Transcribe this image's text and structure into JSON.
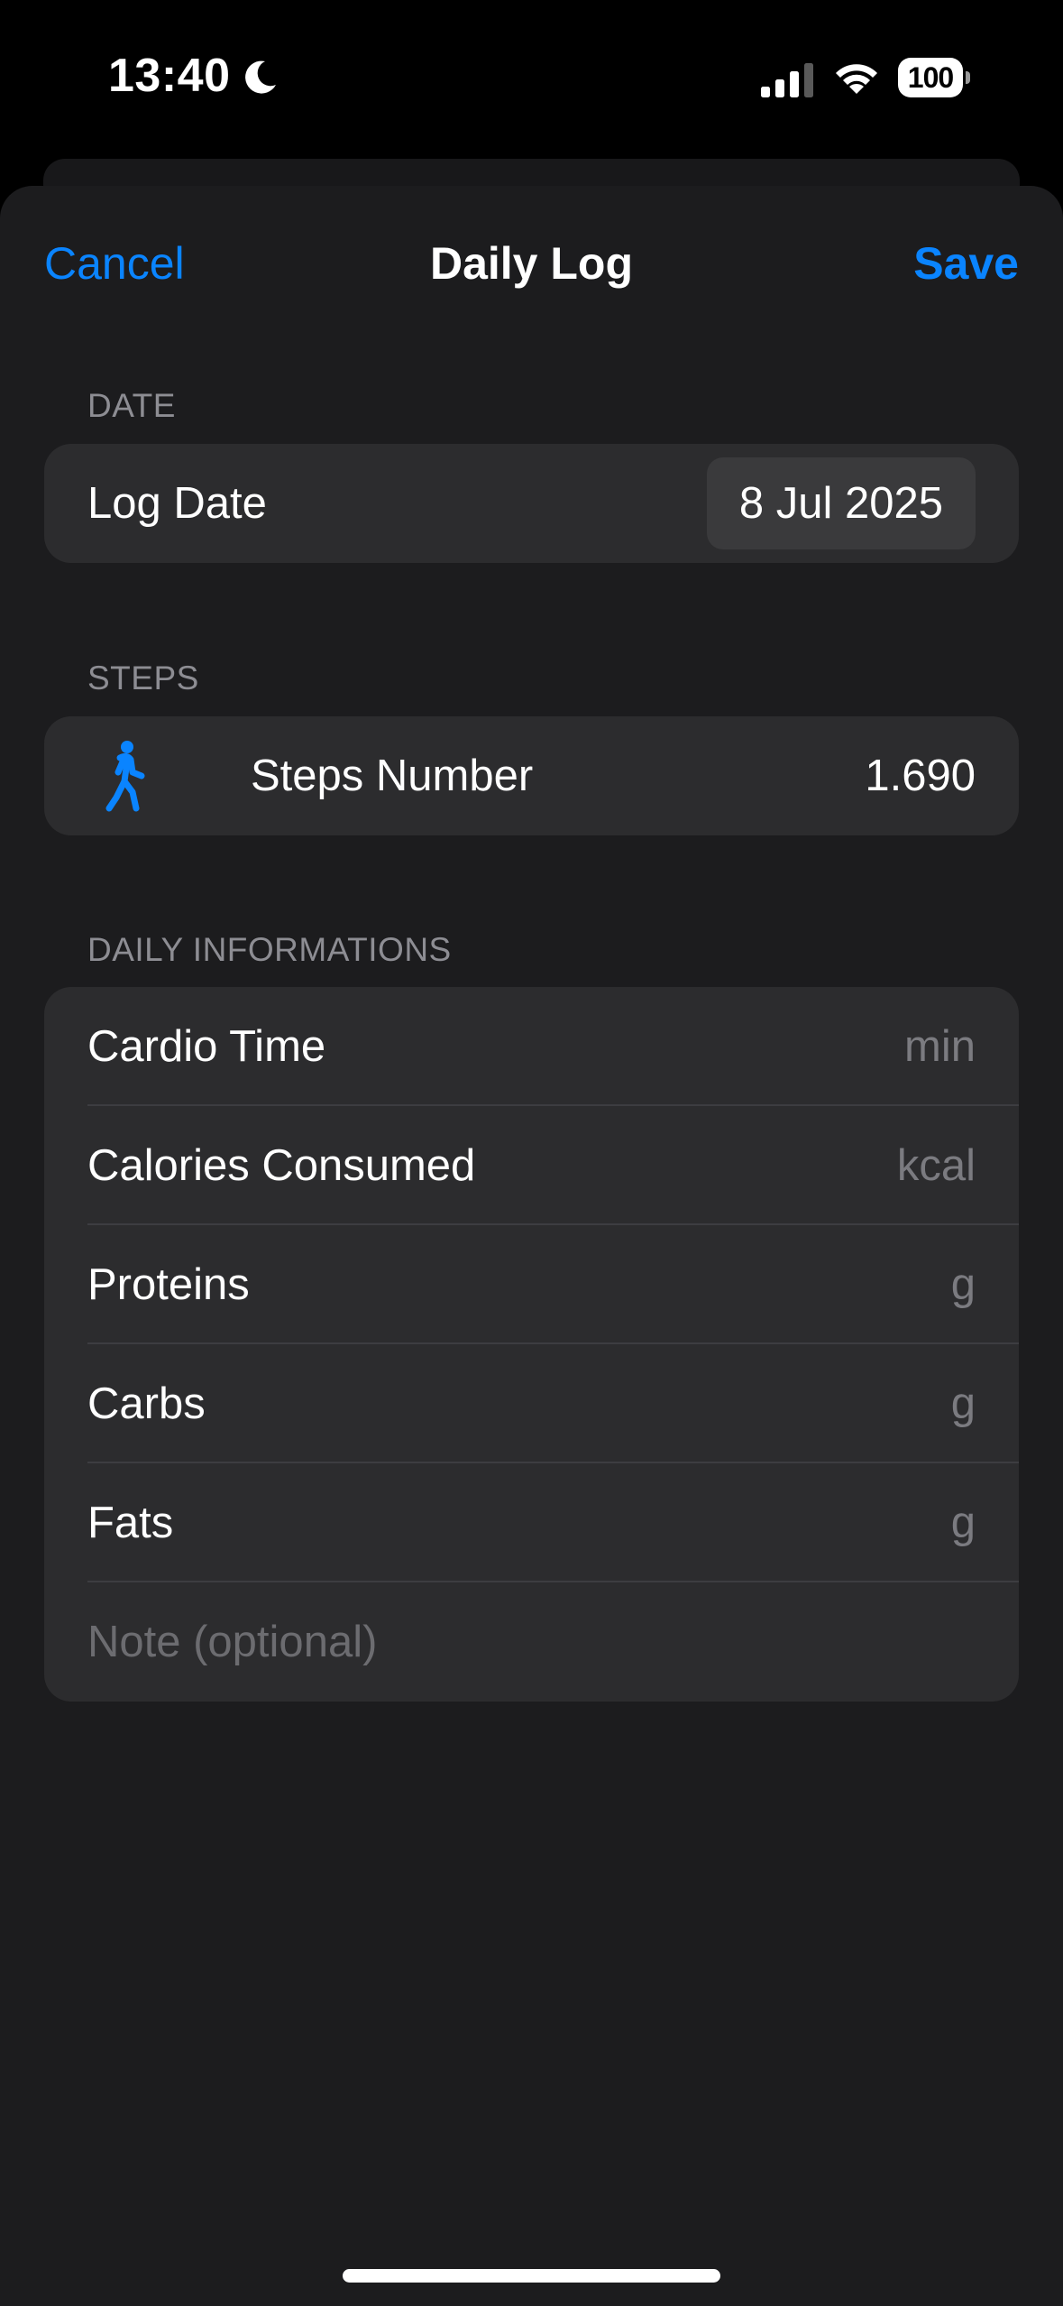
{
  "status_bar": {
    "time": "13:40",
    "battery": "100",
    "icons": [
      "moon-icon",
      "cellular-signal-icon",
      "wifi-icon",
      "battery-icon"
    ]
  },
  "nav": {
    "cancel_label": "Cancel",
    "title": "Daily Log",
    "save_label": "Save"
  },
  "sections": {
    "date": {
      "header": "DATE",
      "log_date_label": "Log Date",
      "log_date_value": "8 Jul 2025"
    },
    "steps": {
      "header": "STEPS",
      "icon": "figure-walk-icon",
      "label": "Steps Number",
      "value": "1.690"
    },
    "daily": {
      "header": "DAILY INFORMATIONS",
      "rows": [
        {
          "label": "Cardio Time",
          "unit": "min"
        },
        {
          "label": "Calories Consumed",
          "unit": "kcal"
        },
        {
          "label": "Proteins",
          "unit": "g"
        },
        {
          "label": "Carbs",
          "unit": "g"
        },
        {
          "label": "Fats",
          "unit": "g"
        }
      ],
      "note_placeholder": "Note (optional)"
    }
  },
  "colors": {
    "accent": "#0a84ff",
    "background": "#000000",
    "sheet": "#1c1c1e",
    "group": "#2c2c2e",
    "secondary_text": "#8d8d93"
  }
}
